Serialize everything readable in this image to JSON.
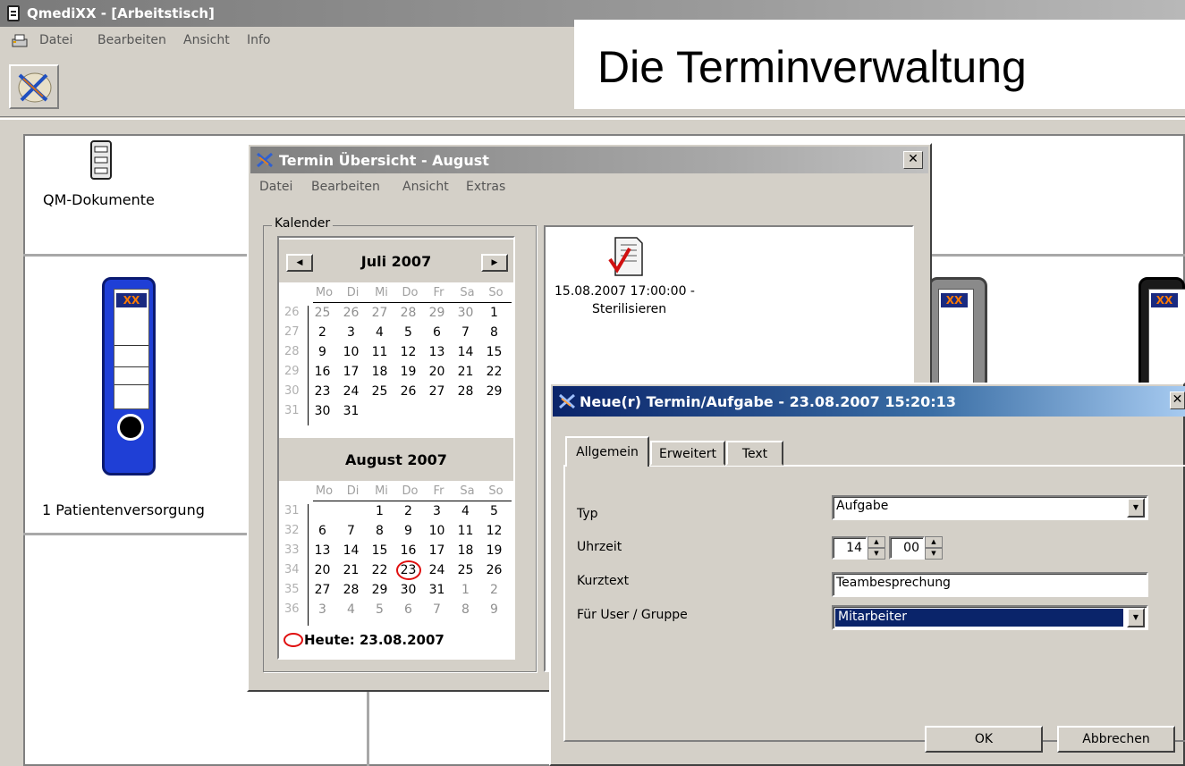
{
  "app": {
    "title": "QmediXX - [Arbeitstisch]"
  },
  "menu": {
    "items": [
      "Datei",
      "Bearbeiten",
      "Ansicht",
      "Info"
    ]
  },
  "slide_title": "Die Terminverwaltung",
  "desktop": {
    "qm_label": "QM-Dokumente",
    "patient_label": "1 Patientenversorgung",
    "binder_logo": "XX"
  },
  "termin_window": {
    "title": "Termin Übersicht - August",
    "menu": [
      "Datei",
      "Bearbeiten",
      "Ansicht",
      "Extras"
    ],
    "calendar_group": "Kalender",
    "prev_icon": "left-arrow-icon",
    "next_icon": "right-arrow-icon",
    "july": {
      "title": "Juli 2007",
      "weekdays": [
        "Mo",
        "Di",
        "Mi",
        "Do",
        "Fr",
        "Sa",
        "So"
      ],
      "weeks": [
        {
          "num": "26",
          "days": [
            "25",
            "26",
            "27",
            "28",
            "29",
            "30",
            "1"
          ]
        },
        {
          "num": "27",
          "days": [
            "2",
            "3",
            "4",
            "5",
            "6",
            "7",
            "8"
          ]
        },
        {
          "num": "28",
          "days": [
            "9",
            "10",
            "11",
            "12",
            "13",
            "14",
            "15"
          ]
        },
        {
          "num": "29",
          "days": [
            "16",
            "17",
            "18",
            "19",
            "20",
            "21",
            "22"
          ]
        },
        {
          "num": "30",
          "days": [
            "23",
            "24",
            "25",
            "26",
            "27",
            "28",
            "29"
          ]
        },
        {
          "num": "31",
          "days": [
            "30",
            "31",
            "",
            "",
            "",
            "",
            ""
          ]
        }
      ]
    },
    "august": {
      "title": "August 2007",
      "weekdays": [
        "Mo",
        "Di",
        "Mi",
        "Do",
        "Fr",
        "Sa",
        "So"
      ],
      "weeks": [
        {
          "num": "31",
          "days": [
            "",
            "",
            "1",
            "2",
            "3",
            "4",
            "5"
          ]
        },
        {
          "num": "32",
          "days": [
            "6",
            "7",
            "8",
            "9",
            "10",
            "11",
            "12"
          ]
        },
        {
          "num": "33",
          "days": [
            "13",
            "14",
            "15",
            "16",
            "17",
            "18",
            "19"
          ]
        },
        {
          "num": "34",
          "days": [
            "20",
            "21",
            "22",
            "23",
            "24",
            "25",
            "26"
          ]
        },
        {
          "num": "35",
          "days": [
            "27",
            "28",
            "29",
            "30",
            "31",
            "1",
            "2"
          ]
        },
        {
          "num": "36",
          "days": [
            "3",
            "4",
            "5",
            "6",
            "7",
            "8",
            "9"
          ]
        }
      ],
      "today_day": "23"
    },
    "today_text": "Heute: 23.08.2007",
    "entry": {
      "line1": "15.08.2007 17:00:00 -",
      "line2": "Sterilisieren"
    }
  },
  "new_dialog": {
    "title": "Neue(r) Termin/Aufgabe - 23.08.2007 15:20:13",
    "tabs": [
      "Allgemein",
      "Erweitert",
      "Text"
    ],
    "labels": {
      "typ": "Typ",
      "uhrzeit": "Uhrzeit",
      "kurztext": "Kurztext",
      "user": "Für User / Gruppe"
    },
    "values": {
      "typ": "Aufgabe",
      "hour": "14",
      "minute": "00",
      "kurztext": "Teambesprechung",
      "user": "Mitarbeiter"
    },
    "buttons": {
      "ok": "OK",
      "cancel": "Abbrechen"
    }
  },
  "colors": {
    "accent_blue": "#0a246a",
    "binder_blue": "#1f3fd6",
    "today_circle": "#e01010"
  }
}
